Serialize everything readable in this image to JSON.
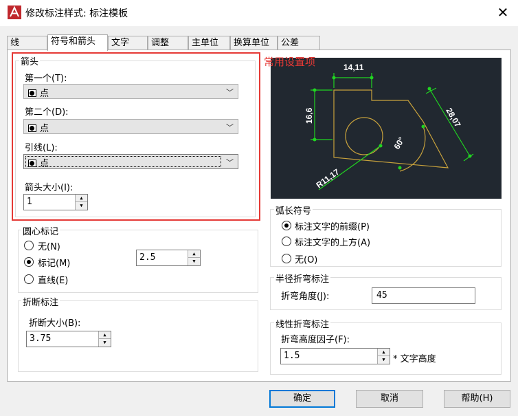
{
  "window": {
    "title": "修改标注样式: 标注模板",
    "close_glyph": "✕"
  },
  "tabs": [
    {
      "label": "线"
    },
    {
      "label": "符号和箭头"
    },
    {
      "label": "文字"
    },
    {
      "label": "调整"
    },
    {
      "label": "主单位"
    },
    {
      "label": "换算单位"
    },
    {
      "label": "公差"
    }
  ],
  "arrows": {
    "group_label": "箭头",
    "first_label": "第一个(T):",
    "first_value": "点",
    "second_label": "第二个(D):",
    "second_value": "点",
    "leader_label": "引线(L):",
    "leader_value": "点",
    "size_label": "箭头大小(I):",
    "size_value": "1"
  },
  "annotation": "常用设置项",
  "preview": {
    "dims": {
      "top": "14,11",
      "left": "16,6",
      "right": "28,07",
      "angle": "60°",
      "radius": "R11,17"
    },
    "colors": {
      "background": "#212830",
      "shape": "#c8a23c",
      "dimension": "#21d421"
    }
  },
  "center_mark": {
    "group_label": "圆心标记",
    "options": [
      {
        "label": "无(N)",
        "checked": false
      },
      {
        "label": "标记(M)",
        "checked": true
      },
      {
        "label": "直线(E)",
        "checked": false
      }
    ],
    "size_value": "2.5"
  },
  "break_dim": {
    "group_label": "折断标注",
    "size_label": "折断大小(B):",
    "size_value": "3.75"
  },
  "arc_symbol": {
    "group_label": "弧长符号",
    "options": [
      {
        "label": "标注文字的前缀(P)",
        "checked": true
      },
      {
        "label": "标注文字的上方(A)",
        "checked": false
      },
      {
        "label": "无(O)",
        "checked": false
      }
    ]
  },
  "radius_jog": {
    "group_label": "半径折弯标注",
    "angle_label": "折弯角度(J):",
    "angle_value": "45"
  },
  "linear_jog": {
    "group_label": "线性折弯标注",
    "factor_label": "折弯高度因子(F):",
    "factor_value": "1.5",
    "suffix": "* 文字高度"
  },
  "buttons": {
    "ok": "确定",
    "cancel": "取消",
    "help": "帮助(H)"
  }
}
